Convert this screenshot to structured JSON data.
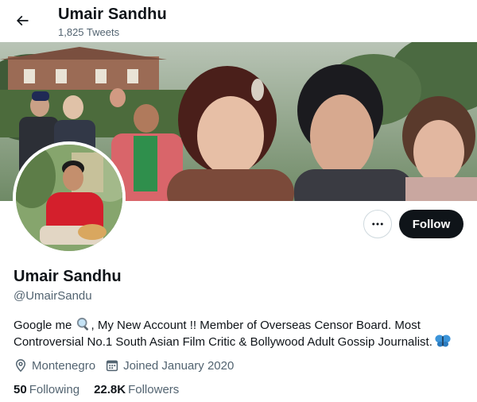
{
  "header": {
    "title": "Umair Sandhu",
    "tweet_count": "1,825 Tweets"
  },
  "profile": {
    "name": "Umair Sandhu",
    "handle": "@UmairSandu",
    "bio_line1_start": "Google me",
    "bio_line1_end": ", My New Account !! Member of Overseas Censor Board. Most",
    "bio_line2": "Controversial No.1 South Asian Film Critic & Bollywood Adult Gossip Journalist.",
    "location": "Montenegro",
    "joined": "Joined January 2020",
    "following_count": "50",
    "following_label": "Following",
    "followers_count": "22.8K",
    "followers_label": "Followers"
  },
  "actions": {
    "follow_label": "Follow"
  },
  "icons": {
    "back": "arrow-left-icon",
    "more": "more-dots-icon",
    "location": "location-pin-icon",
    "calendar": "calendar-icon",
    "bio_emoji_1": "magnifying-glass-emoji",
    "bio_emoji_2": "butterfly-emoji"
  },
  "colors": {
    "follow_bg": "#0f1419",
    "secondary_text": "#536471",
    "border": "#cfd9de"
  }
}
